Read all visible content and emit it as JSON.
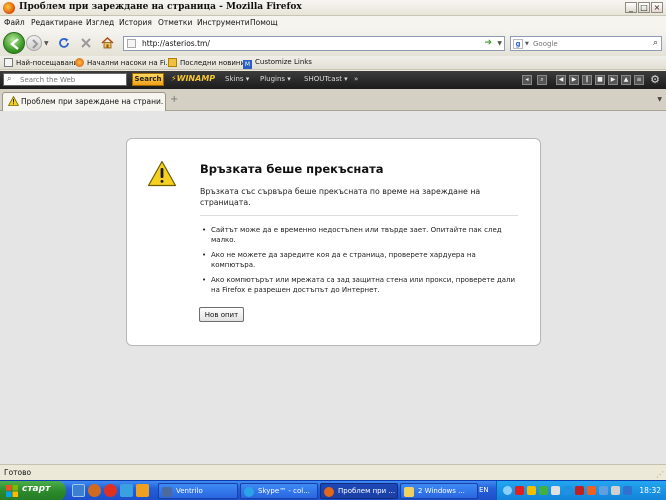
{
  "window": {
    "title": "Проблем при зареждане на страница - Mozilla Firefox",
    "controls": {
      "minimize": "_",
      "maximize": "□",
      "close": "×"
    }
  },
  "menu": {
    "items": [
      "Файл",
      "Редактиране",
      "Изглед",
      "История",
      "Отметки",
      "Инструменти",
      "Помощ"
    ]
  },
  "navigation": {
    "url": "http://asterios.tm/",
    "search_placeholder": "Google",
    "search_engine_letter": "g"
  },
  "bookmarks": {
    "items": [
      {
        "label": "Най-посещавани",
        "icon": "bookmarks-icon"
      },
      {
        "label": "Начални насоки на Fi...",
        "icon": "firefox-icon"
      },
      {
        "label": "Последни новини",
        "icon": "rss-folder-icon"
      },
      {
        "label": "Customize Links",
        "icon": "m-icon"
      }
    ]
  },
  "winamp": {
    "search_placeholder": "Search the Web",
    "search_button": "Search",
    "logo": "WINAMP",
    "menu": [
      "Skins ▾",
      "Plugins ▾",
      "SHOUTcast ▾",
      "»"
    ]
  },
  "tabs": {
    "active_label": "Проблем при зареждане на страни...",
    "new_tab": "+"
  },
  "error": {
    "title": "Връзката беше прекъсната",
    "description": "Връзката със сървъра беше прекъсната по време на зареждане на страницата.",
    "bullets": [
      "Сайтът може да е временно недостъпен или твърде зает. Опитайте пак след малко.",
      "Ако не можете да заредите коя да е страница, проверете хардуера на компютъра.",
      "Ако компютърът или мрежата са зад защитна стена или прокси, проверете дали на Firefox е разрешен достъпът до Интернет."
    ],
    "retry_button": "Нов опит"
  },
  "status": {
    "text": "Готово"
  },
  "taskbar": {
    "start_label": "старт",
    "tasks": [
      {
        "label": "Ventrilo",
        "active": false
      },
      {
        "label": "Skype™ - col...",
        "active": false
      },
      {
        "label": "Проблем при ...",
        "active": true
      },
      {
        "label": "2 Windows ...",
        "active": false
      }
    ],
    "language": "EN",
    "clock": "18:32"
  },
  "colors": {
    "accent_green": "#3d9a28",
    "taskbar_blue": "#245edb",
    "warning_yellow": "#f5d020"
  }
}
